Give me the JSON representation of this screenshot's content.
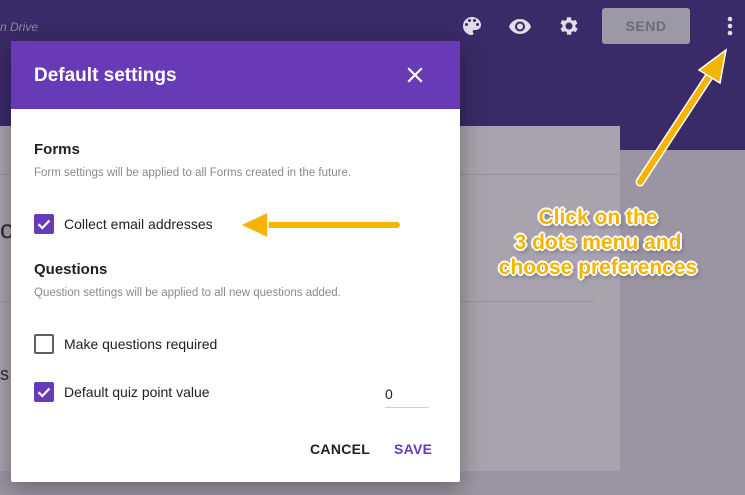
{
  "app": {
    "drive_text": "n Drive",
    "send_label": "SEND"
  },
  "icons": {
    "palette": "palette-icon",
    "preview": "eye-icon",
    "settings": "gear-icon",
    "more": "more-vert-icon",
    "close": "close-icon"
  },
  "dialog": {
    "title": "Default settings",
    "forms": {
      "title": "Forms",
      "description": "Form settings will be applied to all Forms created in the future.",
      "collect_email": {
        "label": "Collect email addresses",
        "checked": true
      }
    },
    "questions": {
      "title": "Questions",
      "description": "Question settings will be applied to all new questions added.",
      "make_required": {
        "label": "Make questions required",
        "checked": false
      },
      "quiz_points": {
        "label": "Default quiz point value",
        "checked": true,
        "value": "0"
      }
    },
    "cancel_label": "CANCEL",
    "save_label": "SAVE"
  },
  "annotation": {
    "lines": [
      "Click on the",
      "3 dots menu and",
      "choose preferences"
    ],
    "color": "#f5b400"
  },
  "colors": {
    "accent": "#673ab7",
    "topbar": "#3a2a67"
  }
}
